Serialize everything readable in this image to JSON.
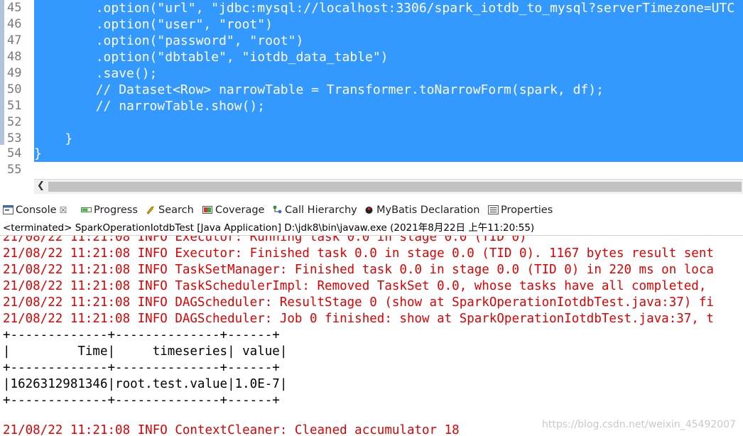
{
  "editor": {
    "lines": [
      {
        "num": "45",
        "text": "        .option(\"url\", \"jdbc:mysql://localhost:3306/spark_iotdb_to_mysql?serverTimezone=UTC"
      },
      {
        "num": "46",
        "text": "        .option(\"user\", \"root\")"
      },
      {
        "num": "47",
        "text": "        .option(\"password\", \"root\")"
      },
      {
        "num": "48",
        "text": "        .option(\"dbtable\", \"iotdb_data_table\")"
      },
      {
        "num": "49",
        "text": "        .save();"
      },
      {
        "num": "50",
        "text": "        // Dataset<Row> narrowTable = Transformer.toNarrowForm(spark, df);"
      },
      {
        "num": "51",
        "text": "        // narrowTable.show();"
      },
      {
        "num": "52",
        "text": ""
      },
      {
        "num": "53",
        "text": "    }"
      },
      {
        "num": "54",
        "text": "}"
      },
      {
        "num": "55",
        "text": ""
      }
    ]
  },
  "tabs": [
    {
      "label": "Console",
      "close": "☒"
    },
    {
      "label": "Progress"
    },
    {
      "label": "Search"
    },
    {
      "label": "Coverage"
    },
    {
      "label": "Call Hierarchy"
    },
    {
      "label": "MyBatis Declaration"
    },
    {
      "label": "Properties"
    }
  ],
  "status": "<terminated> SparkOperationIotdbTest [Java Application] D:\\jdk8\\bin\\javaw.exe (2021年8月22日 上午11:20:55)",
  "console": {
    "lines": [
      {
        "text": "21/08/22 11:21:08 INFO Executor: Running task 0.0 in stage 0.0 (TID 0)",
        "color": "red"
      },
      {
        "text": "21/08/22 11:21:08 INFO Executor: Finished task 0.0 in stage 0.0 (TID 0). 1167 bytes result sent",
        "color": "red"
      },
      {
        "text": "21/08/22 11:21:08 INFO TaskSetManager: Finished task 0.0 in stage 0.0 (TID 0) in 220 ms on loca",
        "color": "red"
      },
      {
        "text": "21/08/22 11:21:08 INFO TaskSchedulerImpl: Removed TaskSet 0.0, whose tasks have all completed,",
        "color": "red"
      },
      {
        "text": "21/08/22 11:21:08 INFO DAGScheduler: ResultStage 0 (show at SparkOperationIotdbTest.java:37) fi",
        "color": "red"
      },
      {
        "text": "21/08/22 11:21:08 INFO DAGScheduler: Job 0 finished: show at SparkOperationIotdbTest.java:37, t",
        "color": "red"
      },
      {
        "text": "+-------------+--------------+------+",
        "color": "blk"
      },
      {
        "text": "|         Time|     timeseries| value|",
        "color": "blk"
      },
      {
        "text": "+-------------+--------------+------+",
        "color": "blk"
      },
      {
        "text": "|1626312981346|root.test.value|1.0E-7|",
        "color": "blk"
      },
      {
        "text": "+-------------+--------------+------+",
        "color": "blk"
      },
      {
        "text": "",
        "color": "blk"
      },
      {
        "text": "21/08/22 11:21:08 INFO ContextCleaner: Cleaned accumulator 18",
        "color": "red"
      }
    ]
  },
  "watermark": "https://blog.csdn.net/weixin_45492007",
  "colors": {
    "selection": "#3399ff",
    "log_red": "#e00000"
  },
  "icons": [
    "console-icon",
    "progress-icon",
    "search-icon",
    "coverage-icon",
    "call-hierarchy-icon",
    "mybatis-icon",
    "properties-icon"
  ]
}
